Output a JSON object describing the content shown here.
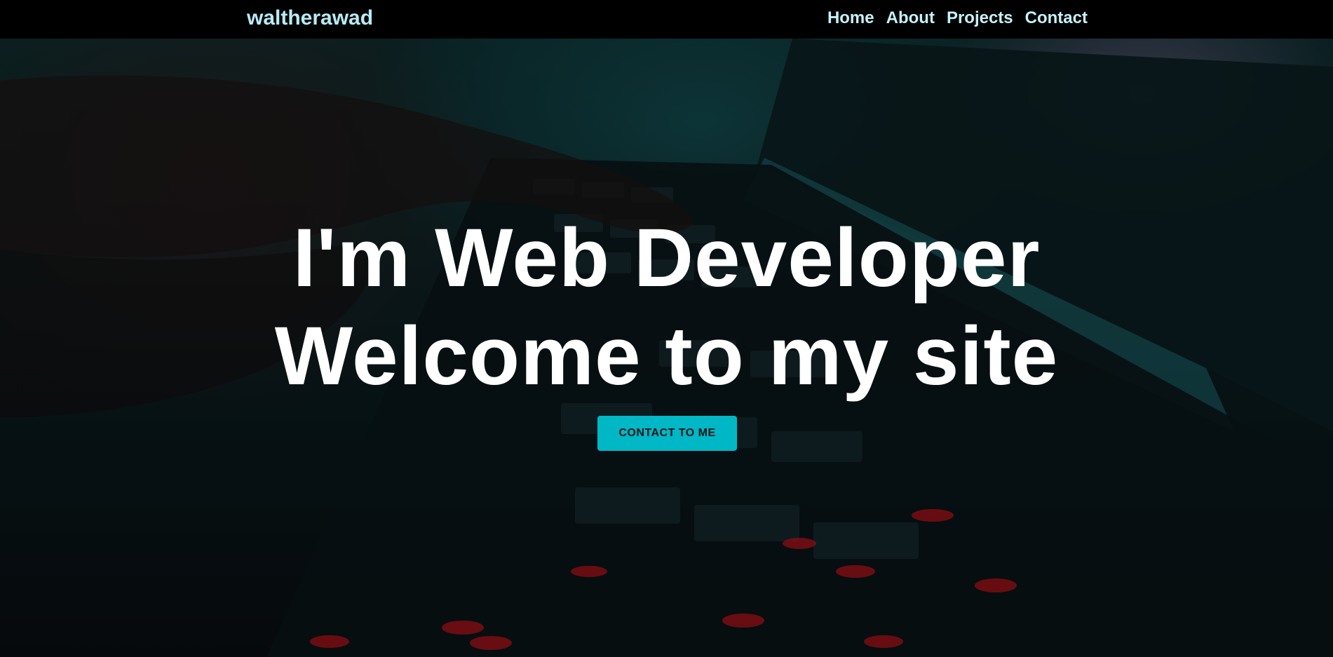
{
  "header": {
    "brand": "waltherawad",
    "nav": [
      {
        "label": "Home"
      },
      {
        "label": "About"
      },
      {
        "label": "Projects"
      },
      {
        "label": "Contact"
      }
    ]
  },
  "hero": {
    "line1": "I'm Web Developer",
    "line2": "Welcome to my site",
    "cta_label": "CONTACT TO ME",
    "background_image": "laptop-keyboard-photo"
  },
  "colors": {
    "brand": "#b6ecf7",
    "nav_link": "#c5f1fa",
    "cta_bg": "#00b7c6",
    "headline": "#ffffff",
    "navbar_bg": "#000000"
  }
}
